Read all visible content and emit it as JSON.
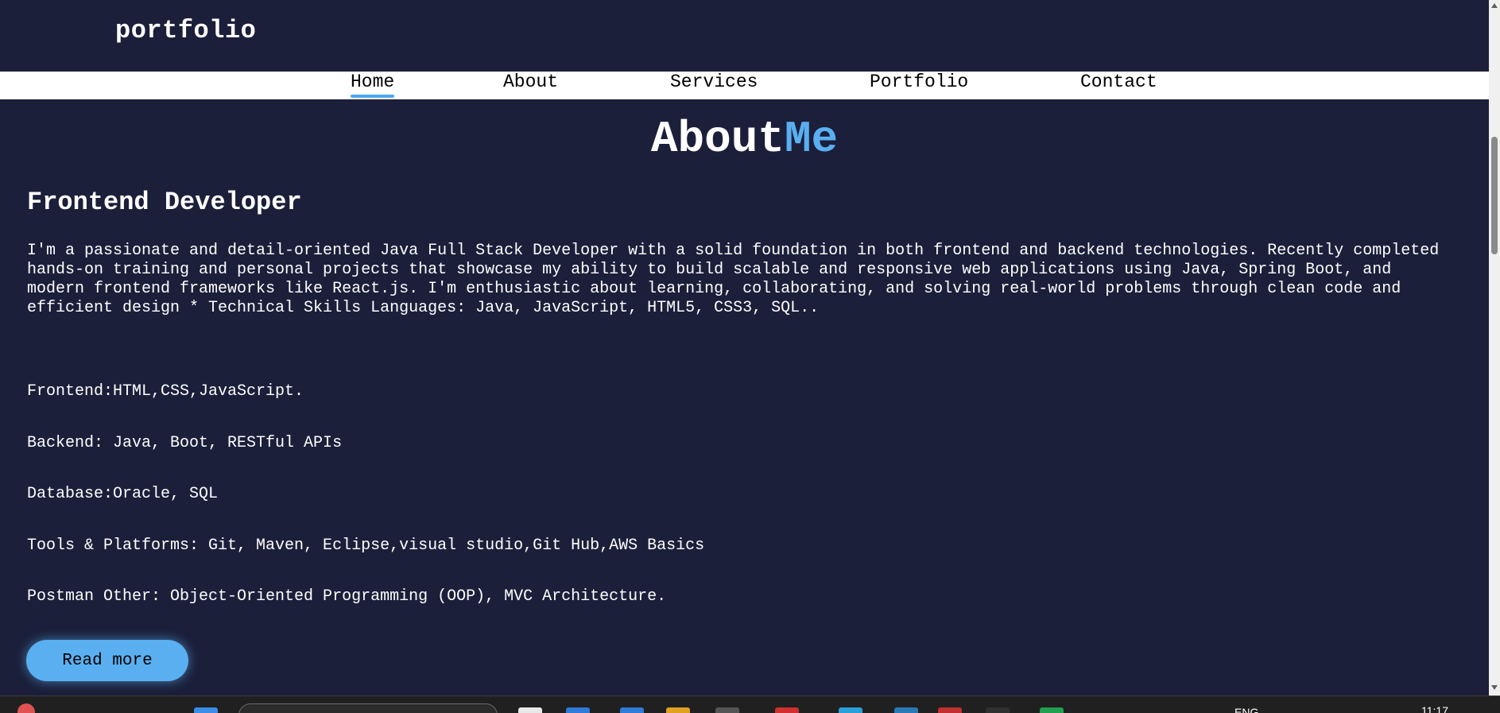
{
  "header": {
    "logo": "portfolio"
  },
  "nav": {
    "items": [
      {
        "label": "Home",
        "active": true
      },
      {
        "label": "About",
        "active": false
      },
      {
        "label": "Services",
        "active": false
      },
      {
        "label": "Portfolio",
        "active": false
      },
      {
        "label": "Contact",
        "active": false
      }
    ]
  },
  "about": {
    "title_part1": "About",
    "title_part2": "Me",
    "subtitle": "Frontend Developer",
    "intro": "I'm a passionate and detail-oriented Java Full Stack Developer with a solid foundation in both frontend and backend technologies. Recently completed hands-on training and personal projects that showcase my ability to build scalable and responsive web applications using Java, Spring Boot, and modern frontend frameworks like React.js. I'm enthusiastic about learning, collaborating, and solving real-world problems through clean code and efficient design * Technical Skills Languages: Java, JavaScript, HTML5, CSS3, SQL..",
    "skills": [
      "Frontend:HTML,CSS,JavaScript.",
      "Backend: Java, Boot, RESTful APIs",
      "Database:Oracle, SQL",
      "Tools & Platforms: Git, Maven, Eclipse,visual studio,Git Hub,AWS Basics",
      "Postman Other: Object-Oriented Programming (OOP), MVC Architecture."
    ],
    "read_more_label": "Read more"
  },
  "taskbar": {
    "lang": "ENG",
    "time": "11:17"
  },
  "colors": {
    "background": "#1b1f3a",
    "accent": "#5aaff0",
    "nav_background": "#ffffff"
  }
}
